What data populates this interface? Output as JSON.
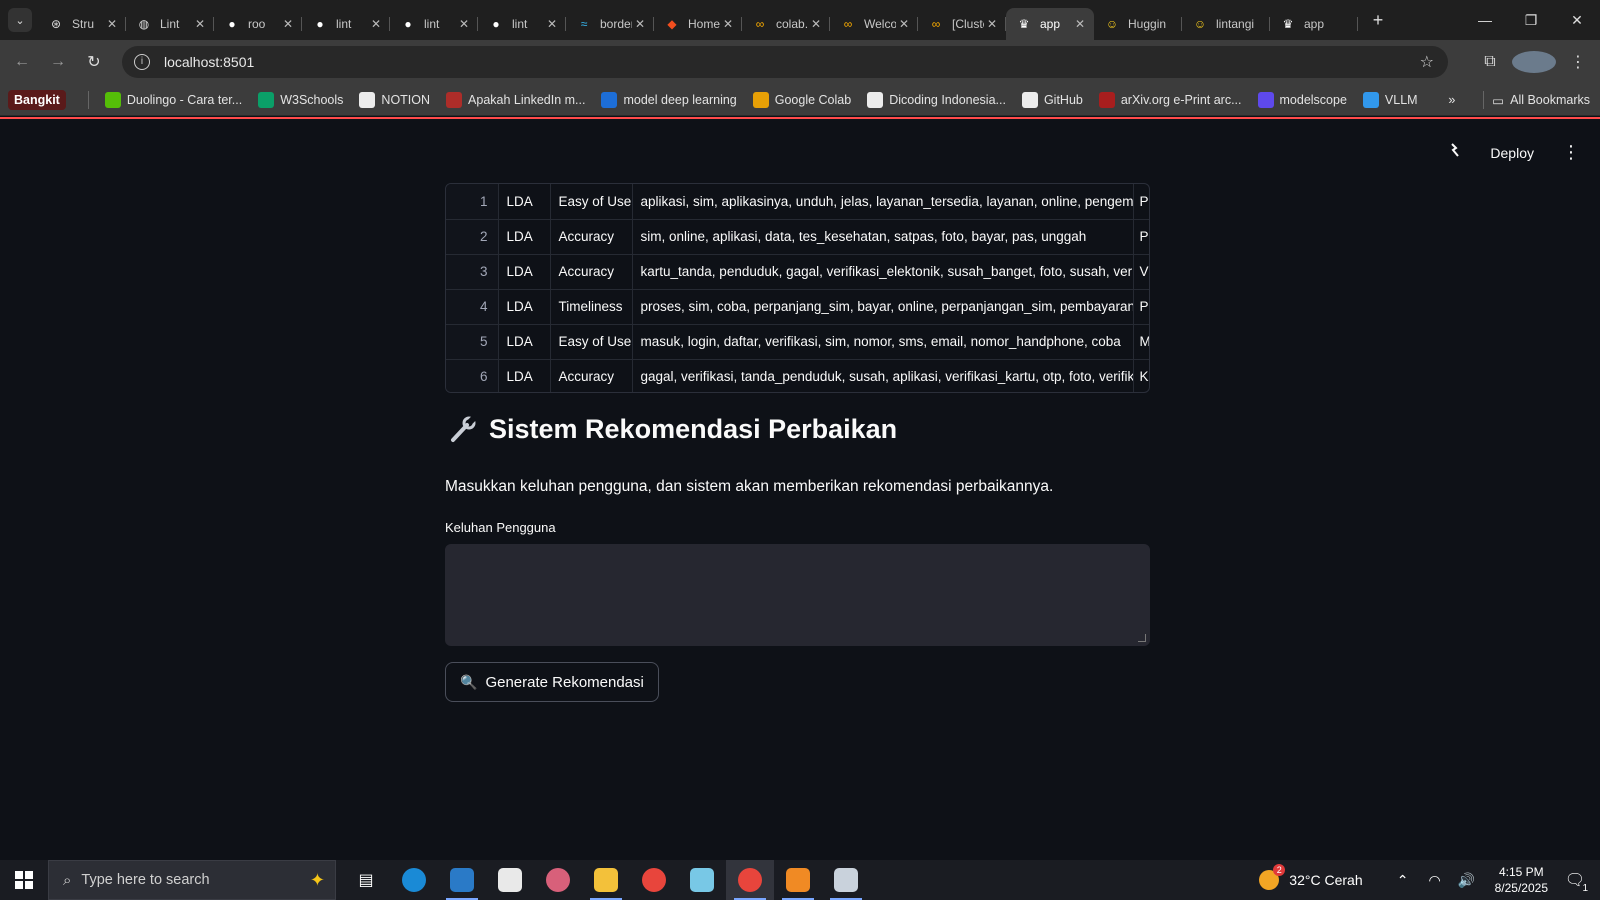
{
  "browser": {
    "tabs": [
      {
        "title": "Stru",
        "icon": "openai-icon"
      },
      {
        "title": "Lint",
        "icon": "globe-icon"
      },
      {
        "title": "roo",
        "icon": "github-icon"
      },
      {
        "title": "lint",
        "icon": "github-icon"
      },
      {
        "title": "lint",
        "icon": "github-icon"
      },
      {
        "title": "lint",
        "icon": "github-icon"
      },
      {
        "title": "border-",
        "icon": "tailwind-icon"
      },
      {
        "title": "Home -",
        "icon": "figma-icon"
      },
      {
        "title": "colab.g",
        "icon": "colab-icon"
      },
      {
        "title": "Welcom",
        "icon": "colab-icon"
      },
      {
        "title": "[Cluster",
        "icon": "colab-icon"
      },
      {
        "title": "app",
        "icon": "streamlit-icon",
        "active": true
      },
      {
        "title": "Huggin",
        "icon": "huggingface-icon"
      },
      {
        "title": "lintangi",
        "icon": "huggingface-icon"
      },
      {
        "title": "app",
        "icon": "streamlit-icon"
      }
    ],
    "url": "localhost:8501",
    "bookmarks": [
      {
        "label": "Duolingo - Cara ter...",
        "icon": "duolingo-icon",
        "color": "#58cc02"
      },
      {
        "label": "W3Schools",
        "icon": "w3schools-icon",
        "color": "#04aa6d"
      },
      {
        "label": "NOTION",
        "icon": "notion-icon",
        "color": "#ffffff"
      },
      {
        "label": "Apakah LinkedIn m...",
        "icon": "quora-icon",
        "color": "#b92b27"
      },
      {
        "label": "model deep learning",
        "icon": "tm-icon",
        "color": "#1a73e8"
      },
      {
        "label": "Google Colab",
        "icon": "colab-icon",
        "color": "#f9ab00"
      },
      {
        "label": "Dicoding Indonesia...",
        "icon": "dicoding-icon",
        "color": "#ffffff"
      },
      {
        "label": "GitHub",
        "icon": "github-icon",
        "color": "#ffffff"
      },
      {
        "label": "arXiv.org e-Print arc...",
        "icon": "arxiv-icon",
        "color": "#b31b1b"
      },
      {
        "label": "modelscope",
        "icon": "modelscope-icon",
        "color": "#624aff"
      },
      {
        "label": "VLLM",
        "icon": "vllm-icon",
        "color": "#30a2ff"
      }
    ],
    "bookmark_folder": "Bangkit",
    "all_bookmarks": "All Bookmarks",
    "overflow": "»"
  },
  "app": {
    "deploy_label": "Deploy",
    "table": {
      "rows": [
        {
          "idx": "1",
          "method": "LDA",
          "aspect": "Easy of Use",
          "keywords": "aplikasi, sim, aplikasinya, unduh, jelas, layanan_tersedia, layanan, online, pengemba",
          "extra": "P"
        },
        {
          "idx": "2",
          "method": "LDA",
          "aspect": "Accuracy",
          "keywords": " sim, online, aplikasi, data, tes_kesehatan, satpas, foto, bayar, pas, unggah",
          "extra": "P"
        },
        {
          "idx": "3",
          "method": "LDA",
          "aspect": "Accuracy",
          "keywords": "kartu_tanda, penduduk, gagal, verifikasi_elektonik, susah_banget, foto, susah, verifil",
          "extra": "V"
        },
        {
          "idx": "4",
          "method": "LDA",
          "aspect": "Timeliness",
          "keywords": "proses, sim, coba, perpanjang_sim, bayar, online, perpanjangan_sim, pembayaran, d",
          "extra": "P"
        },
        {
          "idx": "5",
          "method": "LDA",
          "aspect": "Easy of Use",
          "keywords": " masuk, login, daftar, verifikasi, sim, nomor, sms, email, nomor_handphone, coba",
          "extra": "M"
        },
        {
          "idx": "6",
          "method": "LDA",
          "aspect": "Accuracy",
          "keywords": " gagal, verifikasi, tanda_penduduk, susah, aplikasi, verifikasi_kartu, otp, foto, verifika",
          "extra": "K"
        }
      ]
    },
    "section_title": "Sistem Rekomendasi Perbaikan",
    "description": "Masukkan keluhan pengguna, dan sistem akan memberikan rekomendasi perbaikannya.",
    "input_label": "Keluhan Pengguna",
    "input_value": "",
    "button_label": "Generate Rekomendasi"
  },
  "taskbar": {
    "search_placeholder": "Type here to search",
    "weather": "32°C  Cerah",
    "weather_badge": "2",
    "time": "4:15 PM",
    "date": "8/25/2025",
    "notif_count": "1"
  },
  "colors": {
    "accent": "#ff4b4b",
    "background": "#0e1117",
    "input_bg": "#262730"
  }
}
